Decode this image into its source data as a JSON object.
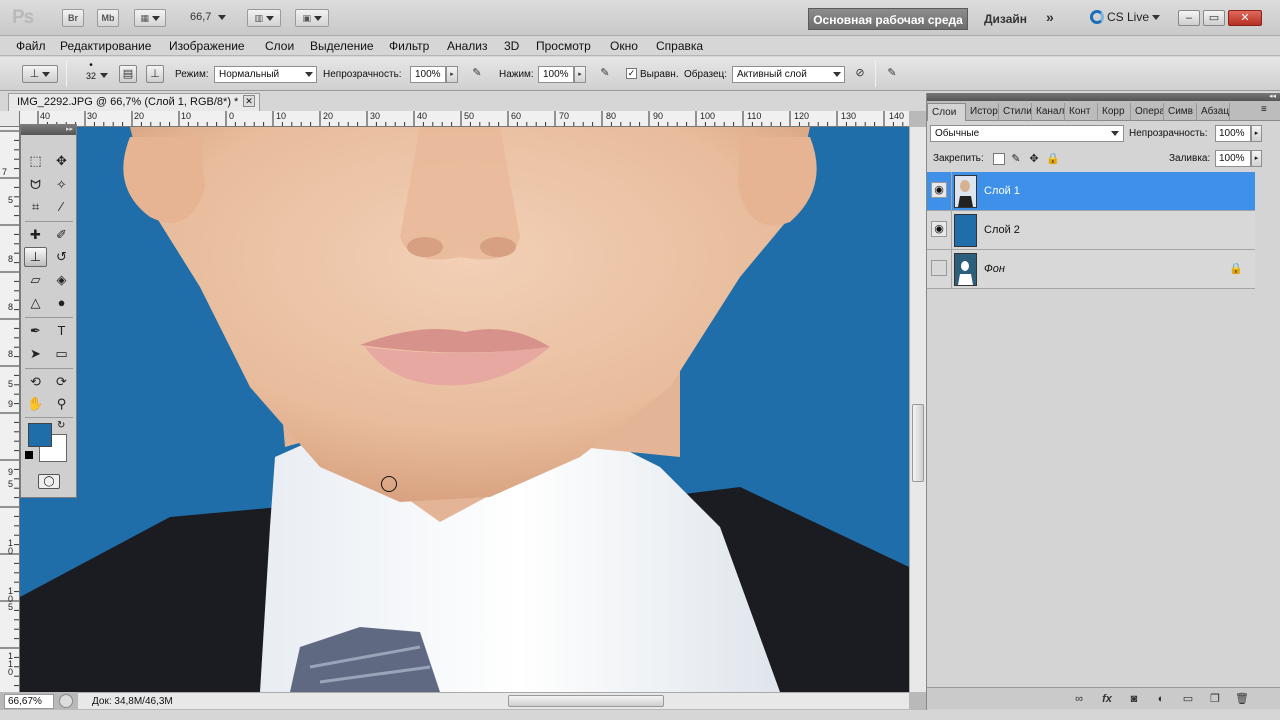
{
  "app": {
    "logo": "Ps",
    "br_label": "Br",
    "mb_label": "Mb",
    "zoom_dropdown": "66,7",
    "workspace_active": "Основная рабочая среда",
    "workspace_design": "Дизайн",
    "more_label": "»",
    "cs_live": "CS Live",
    "win_minimize": "–",
    "win_restore": "▭",
    "win_close": "✕"
  },
  "menu": [
    "Файл",
    "Редактирование",
    "Изображение",
    "Слои",
    "Выделение",
    "Фильтр",
    "Анализ",
    "3D",
    "Просмотр",
    "Окно",
    "Справка"
  ],
  "options": {
    "brush_size": "32",
    "mode_label": "Режим:",
    "mode_value": "Нормальный",
    "opacity_label": "Непрозрачность:",
    "opacity_value": "100%",
    "flow_label": "Нажим:",
    "flow_value": "100%",
    "aligned_label": "Выравн.",
    "aligned_check": "✓",
    "sample_label": "Образец:",
    "sample_value": "Активный слой"
  },
  "document": {
    "tab_title": "IMG_2292.JPG @ 66,7% (Слой 1, RGB/8*) *",
    "tab_close": "✕",
    "ruler_h": [
      "40",
      "30",
      "20",
      "10",
      "0",
      "10",
      "20",
      "30",
      "40",
      "50",
      "60",
      "70",
      "80",
      "90",
      "100",
      "110",
      "120",
      "130",
      "140"
    ],
    "ruler_v": [
      "7",
      "5",
      "8",
      "8",
      "8",
      "5",
      "9",
      "9",
      "5",
      "1 0",
      "1 0 5",
      "1 1 0"
    ],
    "zoom": "66,67%",
    "doc_info": "Док: 34,8M/46,3M"
  },
  "tools_panel": {
    "header": "▸▸",
    "fg_color": "#1f6ea9",
    "bg_color": "#ffffff",
    "quickmask": "◯"
  },
  "panel": {
    "header": "◂◂",
    "tabs": [
      "Слои",
      "Истор",
      "Стили",
      "Канал",
      "Конт",
      "Корр",
      "Опера",
      "Симв",
      "Абзац"
    ],
    "blend_mode": "Обычные",
    "opacity_label": "Непрозрачность:",
    "opacity_value": "100%",
    "lock_label": "Закрепить:",
    "fill_label": "Заливка:",
    "fill_value": "100%",
    "layers": [
      {
        "name": "Слой 1",
        "visible": true,
        "selected": true
      },
      {
        "name": "Слой 2",
        "visible": true,
        "selected": false
      },
      {
        "name": "Фон",
        "visible": false,
        "selected": false,
        "locked": true
      }
    ]
  },
  "colors": {
    "canvas_bg": "#1f6ea9",
    "selection": "#3e90e8"
  }
}
